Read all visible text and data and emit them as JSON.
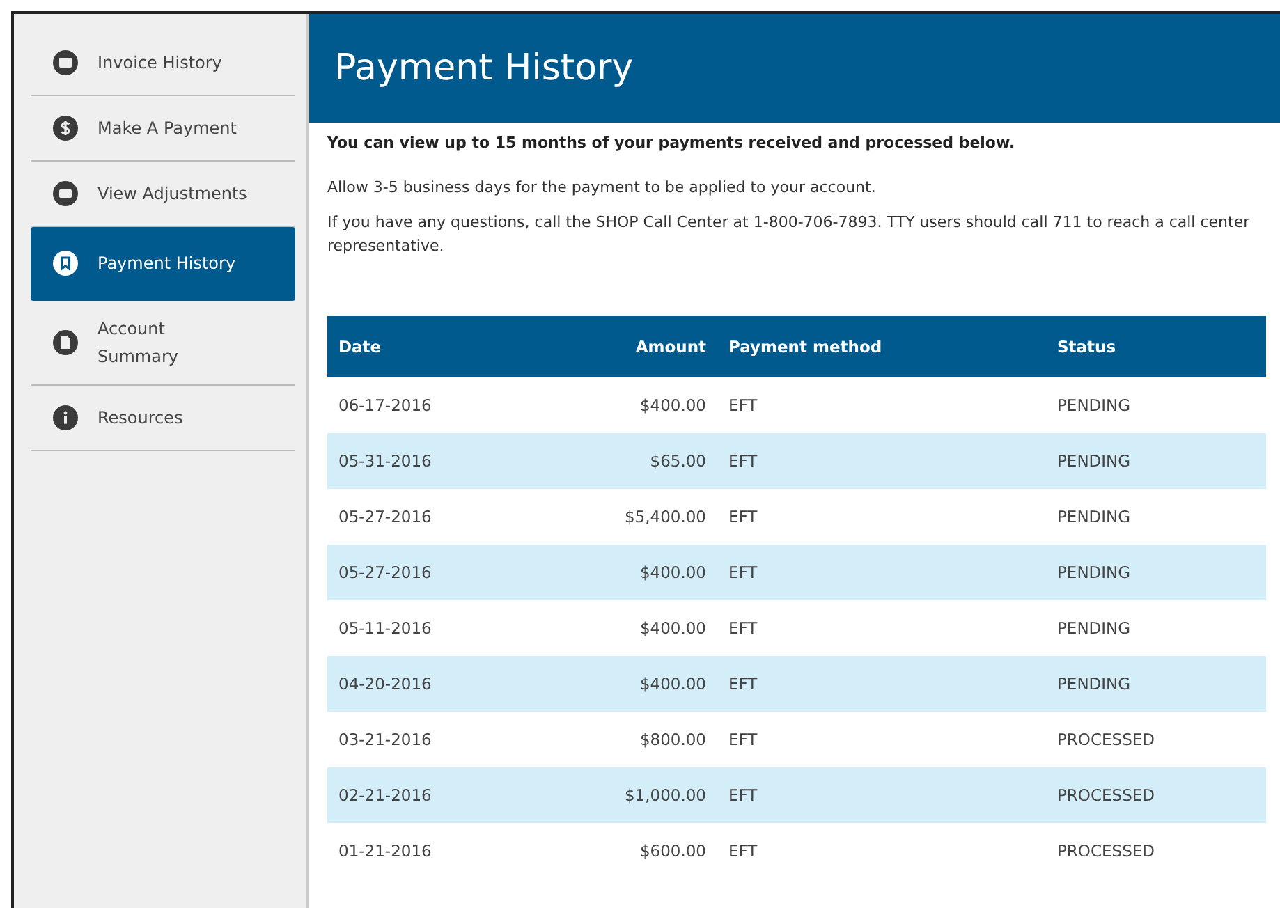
{
  "sidebar": {
    "items": [
      {
        "label": "Invoice History",
        "selected": false
      },
      {
        "label": "Make A Payment",
        "selected": false
      },
      {
        "label": "View Adjustments",
        "selected": false
      },
      {
        "label": "Payment History",
        "selected": true
      },
      {
        "label": "Account Summary",
        "selected": false
      },
      {
        "label": "Resources",
        "selected": false
      }
    ]
  },
  "page_title": "Payment History",
  "intro": {
    "lead": "You can view up to 15 months of your payments received and processed below.",
    "notes": [
      "Allow 3-5 business days for the payment to be applied to your account.",
      "If you have any questions, call the SHOP Call Center at 1-800-706-7893. TTY users should call 711 to reach a call center representative."
    ]
  },
  "table": {
    "columns": [
      "Date",
      "Amount",
      "Payment method",
      "Status"
    ],
    "rows": [
      [
        "06-17-2016",
        "$400.00",
        "EFT",
        "PENDING"
      ],
      [
        "05-31-2016",
        "$65.00",
        "EFT",
        "PENDING"
      ],
      [
        "05-27-2016",
        "$5,400.00",
        "EFT",
        "PENDING"
      ],
      [
        "05-27-2016",
        "$400.00",
        "EFT",
        "PENDING"
      ],
      [
        "05-11-2016",
        "$400.00",
        "EFT",
        "PENDING"
      ],
      [
        "04-20-2016",
        "$400.00",
        "EFT",
        "PENDING"
      ],
      [
        "03-21-2016",
        "$800.00",
        "EFT",
        "PROCESSED"
      ],
      [
        "02-21-2016",
        "$1,000.00",
        "EFT",
        "PROCESSED"
      ],
      [
        "01-21-2016",
        "$600.00",
        "EFT",
        "PROCESSED"
      ]
    ]
  }
}
